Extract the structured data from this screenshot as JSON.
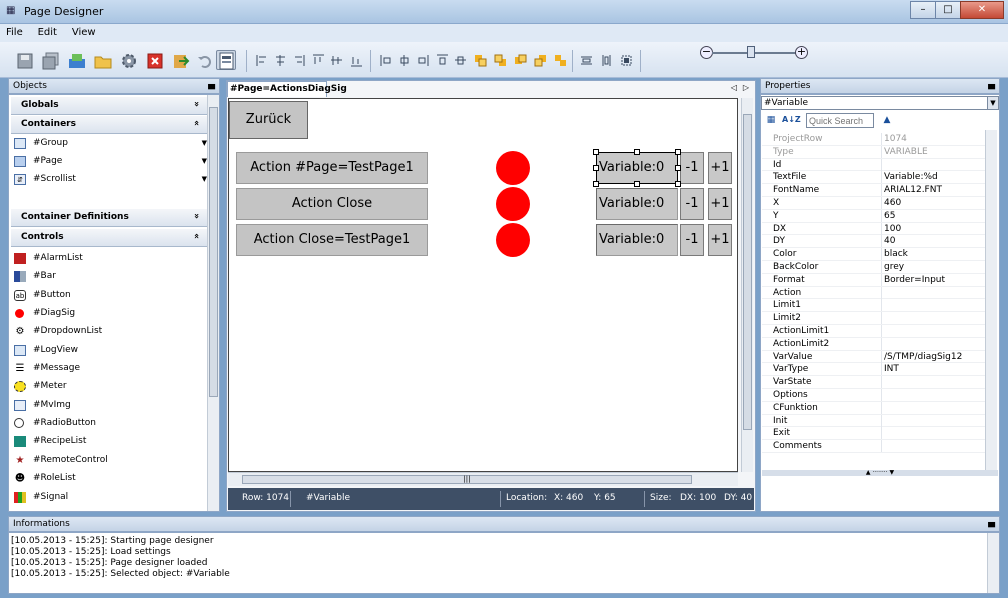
{
  "window": {
    "title": "Page Designer",
    "minimize": "–",
    "maximize": "□",
    "close": "✕"
  },
  "menu": [
    "File",
    "Edit",
    "View"
  ],
  "panels": {
    "objects_title": "Objects",
    "properties_title": "Properties",
    "info_title": "Informations",
    "pin": "▄"
  },
  "objects": {
    "globals": "Globals",
    "containers": "Containers",
    "container_items": [
      "#Group",
      "#Page",
      "#Scrollist"
    ],
    "container_definitions": "Container Definitions",
    "controls": "Controls",
    "control_items": [
      "#AlarmList",
      "#Bar",
      "#Button",
      "#DiagSig",
      "#DropdownList",
      "#LogView",
      "#Message",
      "#Meter",
      "#MvImg",
      "#RadioButton",
      "#RecipeList",
      "#RemoteControl",
      "#RoleList",
      "#Signal"
    ],
    "chev_down": "»",
    "chev_up": "«",
    "dd": "▼"
  },
  "editor": {
    "tab": "#Page=ActionsDiagSig",
    "nav_prev": "◁",
    "nav_next": "▷",
    "back_button": "Zurück",
    "rows": [
      {
        "action": "Action #Page=TestPage1",
        "variable": "Variable:0",
        "minus": "-1",
        "plus": "+1"
      },
      {
        "action": "Action Close",
        "variable": "Variable:0",
        "minus": "-1",
        "plus": "+1"
      },
      {
        "action": "Action Close=TestPage1",
        "variable": "Variable:0",
        "minus": "-1",
        "plus": "+1"
      }
    ],
    "hscroll_grip": "|||",
    "status": {
      "row": "Row: 1074",
      "object": "#Variable",
      "location_label": "Location:",
      "x": "X: 460",
      "y": "Y: 65",
      "size_label": "Size:",
      "dx": "DX: 100",
      "dy": "DY: 40"
    }
  },
  "properties": {
    "selected": "#Variable",
    "search_placeholder": "Quick Search",
    "sort_label": "A↓Z",
    "split_grip": "▲ ········ ▼",
    "rows": [
      {
        "key": "ProjectRow",
        "value": "1074",
        "readonly": true
      },
      {
        "key": "Type",
        "value": "VARIABLE",
        "readonly": true
      },
      {
        "key": "Id",
        "value": ""
      },
      {
        "key": "TextFile",
        "value": "Variable:%d"
      },
      {
        "key": "FontName",
        "value": "ARIAL12.FNT"
      },
      {
        "key": "X",
        "value": "460"
      },
      {
        "key": "Y",
        "value": "65"
      },
      {
        "key": "DX",
        "value": "100"
      },
      {
        "key": "DY",
        "value": "40"
      },
      {
        "key": "Color",
        "value": "black"
      },
      {
        "key": "BackColor",
        "value": "grey"
      },
      {
        "key": "Format",
        "value": "Border=Input"
      },
      {
        "key": "Action",
        "value": ""
      },
      {
        "key": "Limit1",
        "value": ""
      },
      {
        "key": "Limit2",
        "value": ""
      },
      {
        "key": "ActionLimit1",
        "value": ""
      },
      {
        "key": "ActionLimit2",
        "value": ""
      },
      {
        "key": "VarValue",
        "value": "/S/TMP/diagSig12"
      },
      {
        "key": "VarType",
        "value": "INT"
      },
      {
        "key": "VarState",
        "value": ""
      },
      {
        "key": "Options",
        "value": ""
      },
      {
        "key": "CFunktion",
        "value": ""
      },
      {
        "key": "Init",
        "value": ""
      },
      {
        "key": "Exit",
        "value": ""
      },
      {
        "key": "Comments",
        "value": ""
      }
    ]
  },
  "log": [
    "[10.05.2013 - 15:25]:  Starting page designer",
    "[10.05.2013 - 15:25]:  Load settings",
    "[10.05.2013 - 15:25]:  Page designer loaded",
    "[10.05.2013 - 15:25]:  Selected object: #Variable"
  ],
  "colors": {
    "diag_signal": "#ff0000",
    "button_gray": "#c4c4c4",
    "status_bar": "#3e4f66"
  }
}
